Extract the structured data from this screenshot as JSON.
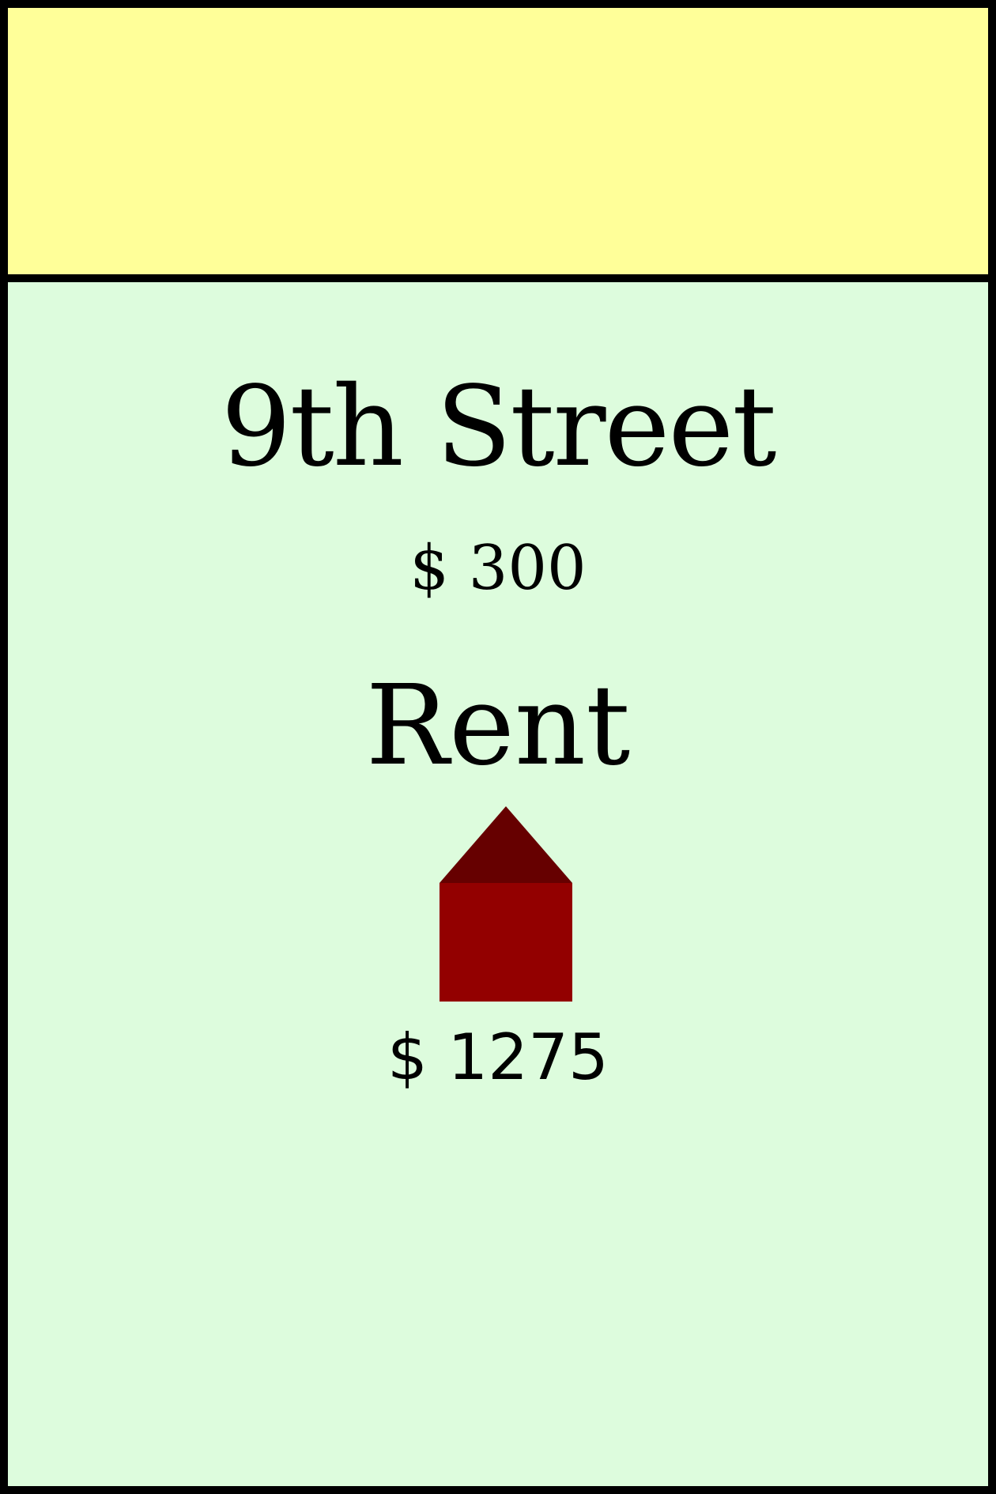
{
  "card": {
    "name": "9th Street",
    "price": "$ 300",
    "rent_heading": "Rent",
    "rent_value": "$ 1275",
    "band_color": "#ffff99",
    "background_color": "#ddfcdd"
  },
  "house": {
    "icon": "house-icon",
    "roof_color": "#660000",
    "wall_color": "#930000"
  }
}
